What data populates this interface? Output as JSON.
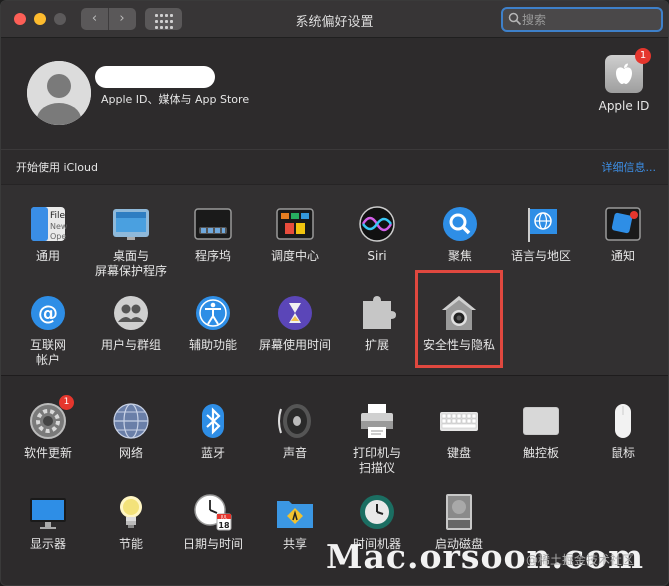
{
  "window": {
    "title": "系统偏好设置",
    "nav": {
      "back": "‹",
      "forward": "›"
    },
    "search": {
      "placeholder": "搜索"
    }
  },
  "profile": {
    "subtitle": "Apple ID、媒体与 App Store",
    "apple_id": {
      "label": "Apple ID",
      "badge": "1"
    }
  },
  "icloud": {
    "text": "开始使用 iCloud",
    "details": "详细信息..."
  },
  "section1": [
    {
      "label": "通用",
      "icon": "general-icon"
    },
    {
      "label": "桌面与\n屏幕保护程序",
      "icon": "desktop-screensaver-icon"
    },
    {
      "label": "程序坞",
      "icon": "dock-icon"
    },
    {
      "label": "调度中心",
      "icon": "mission-control-icon"
    },
    {
      "label": "Siri",
      "icon": "siri-icon"
    },
    {
      "label": "聚焦",
      "icon": "spotlight-icon"
    },
    {
      "label": "语言与地区",
      "icon": "language-region-icon"
    },
    {
      "label": "通知",
      "icon": "notifications-icon"
    },
    {
      "label": "互联网\n帐户",
      "icon": "internet-accounts-icon"
    },
    {
      "label": "用户与群组",
      "icon": "users-groups-icon"
    },
    {
      "label": "辅助功能",
      "icon": "accessibility-icon"
    },
    {
      "label": "屏幕使用时间",
      "icon": "screen-time-icon"
    },
    {
      "label": "扩展",
      "icon": "extensions-icon"
    },
    {
      "label": "安全性与隐私",
      "icon": "security-privacy-icon"
    }
  ],
  "section2": [
    {
      "label": "软件更新",
      "icon": "software-update-icon",
      "badge": "1"
    },
    {
      "label": "网络",
      "icon": "network-icon"
    },
    {
      "label": "蓝牙",
      "icon": "bluetooth-icon"
    },
    {
      "label": "声音",
      "icon": "sound-icon"
    },
    {
      "label": "打印机与\n扫描仪",
      "icon": "printers-scanners-icon"
    },
    {
      "label": "键盘",
      "icon": "keyboard-icon"
    },
    {
      "label": "触控板",
      "icon": "trackpad-icon"
    },
    {
      "label": "鼠标",
      "icon": "mouse-icon"
    },
    {
      "label": "显示器",
      "icon": "displays-icon"
    },
    {
      "label": "节能",
      "icon": "energy-saver-icon"
    },
    {
      "label": "日期与时间",
      "icon": "date-time-icon",
      "calendar_day": "18",
      "calendar_month": "JUL"
    },
    {
      "label": "共享",
      "icon": "sharing-icon"
    },
    {
      "label": "时间机器",
      "icon": "time-machine-icon"
    },
    {
      "label": "启动磁盘",
      "icon": "startup-disk-icon"
    }
  ],
  "watermark": {
    "main": "Mac.orsoon.com",
    "sub": "@稀土掘金技术社区"
  },
  "colors": {
    "accent": "#3d8fe6",
    "highlight": "#e0483f",
    "badge": "#e5362d"
  }
}
